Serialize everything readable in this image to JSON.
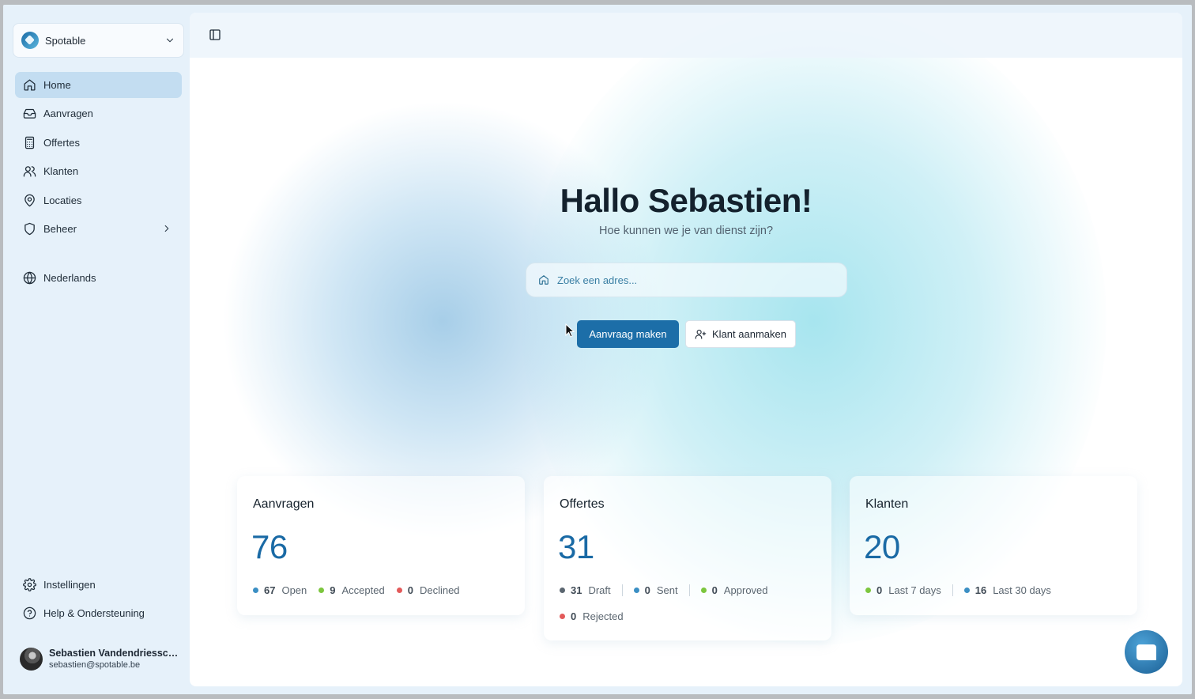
{
  "team": {
    "name": "Spotable"
  },
  "nav": {
    "items": [
      {
        "label": "Home",
        "icon": "home-icon",
        "active": true
      },
      {
        "label": "Aanvragen",
        "icon": "inbox-icon"
      },
      {
        "label": "Offertes",
        "icon": "calculator-icon"
      },
      {
        "label": "Klanten",
        "icon": "users-icon"
      },
      {
        "label": "Locaties",
        "icon": "map-pin-icon"
      },
      {
        "label": "Beheer",
        "icon": "shield-icon"
      }
    ],
    "language": "Nederlands",
    "settings": "Instellingen",
    "help": "Help & Ondersteuning"
  },
  "user": {
    "name": "Sebastien Vandendriessche",
    "email": "sebastien@spotable.be"
  },
  "hero": {
    "title": "Hallo Sebastien!",
    "subtitle": "Hoe kunnen we je van dienst zijn?",
    "search_placeholder": "Zoek een adres...",
    "primary_button": "Aanvraag maken",
    "secondary_button": "Klant aanmaken"
  },
  "cards": {
    "aanvragen": {
      "title": "Aanvragen",
      "value": "76",
      "stats": [
        {
          "num": "67",
          "label": "Open",
          "color": "#3b8fc4"
        },
        {
          "num": "9",
          "label": "Accepted",
          "color": "#7cc63e"
        },
        {
          "num": "0",
          "label": "Declined",
          "color": "#e35a5a"
        }
      ]
    },
    "offertes": {
      "title": "Offertes",
      "value": "31",
      "stats": [
        {
          "num": "31",
          "label": "Draft",
          "color": "#5b6670"
        },
        {
          "num": "0",
          "label": "Sent",
          "color": "#3b8fc4"
        },
        {
          "num": "0",
          "label": "Approved",
          "color": "#7cc63e"
        },
        {
          "num": "0",
          "label": "Rejected",
          "color": "#e35a5a"
        }
      ]
    },
    "klanten": {
      "title": "Klanten",
      "value": "20",
      "stats": [
        {
          "num": "0",
          "label": "Last 7 days",
          "color": "#7cc63e"
        },
        {
          "num": "16",
          "label": "Last 30 days",
          "color": "#3b8fc4"
        }
      ]
    }
  },
  "colors": {
    "accent": "#1c6ea8",
    "sidebar_bg": "#e6f1fa",
    "active_nav": "#c3ddf1"
  }
}
